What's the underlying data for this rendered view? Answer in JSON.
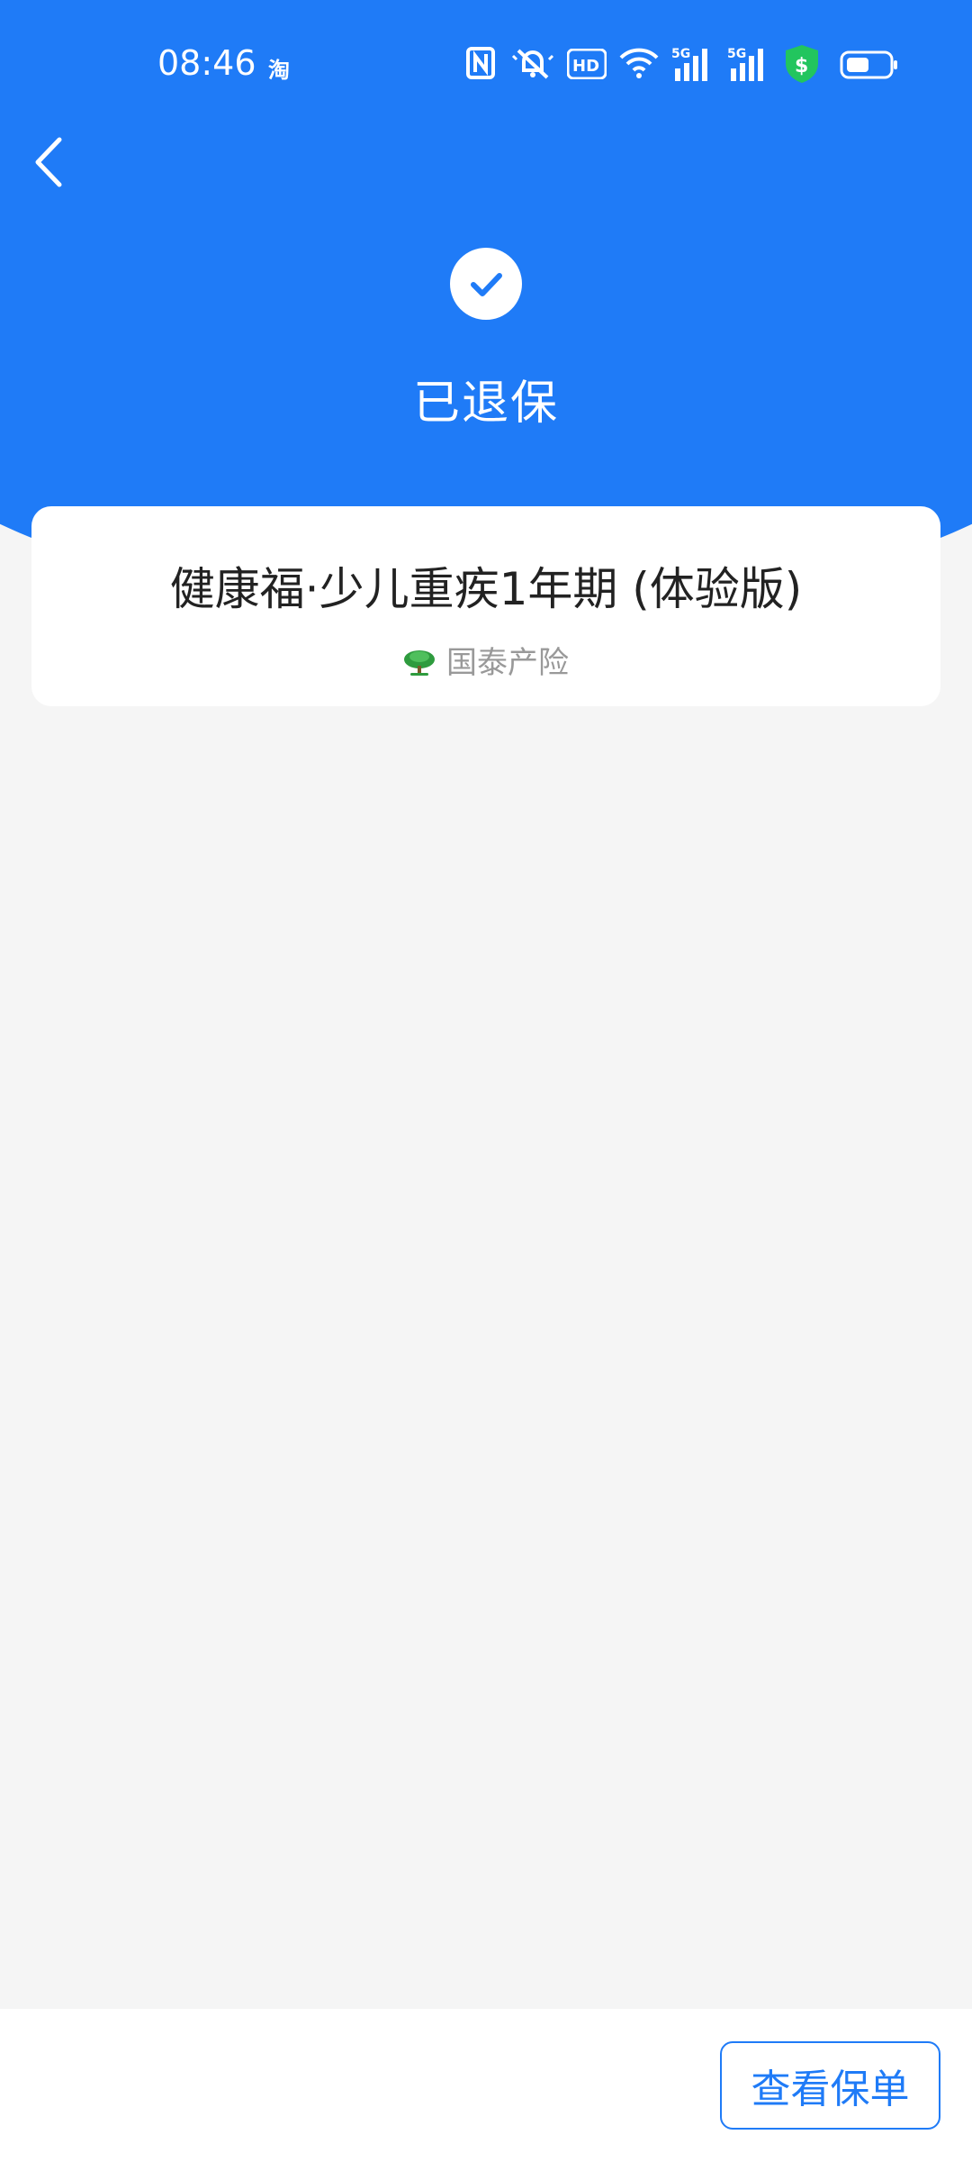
{
  "status_bar": {
    "time": "08:46",
    "app_indicator": "淘",
    "icons": [
      "nfc-icon",
      "mute-icon",
      "hd-icon",
      "wifi-icon",
      "signal-5g-icon",
      "signal-5g-icon",
      "security-icon",
      "battery-icon"
    ],
    "hd_label": "HD",
    "network_label": "5G"
  },
  "header": {
    "back_icon": "back-arrow-icon",
    "status_icon": "check-icon",
    "status_title": "已退保"
  },
  "policy": {
    "product_name": "健康福·少儿重疾1年期 (体验版)",
    "insurer_icon": "tree-logo-icon",
    "insurer_name": "国泰产险"
  },
  "bottom_bar": {
    "view_policy_label": "查看保单"
  },
  "colors": {
    "primary": "#1f7bf7",
    "background": "#f5f5f5",
    "card": "#ffffff",
    "security_badge": "#22c55e"
  }
}
